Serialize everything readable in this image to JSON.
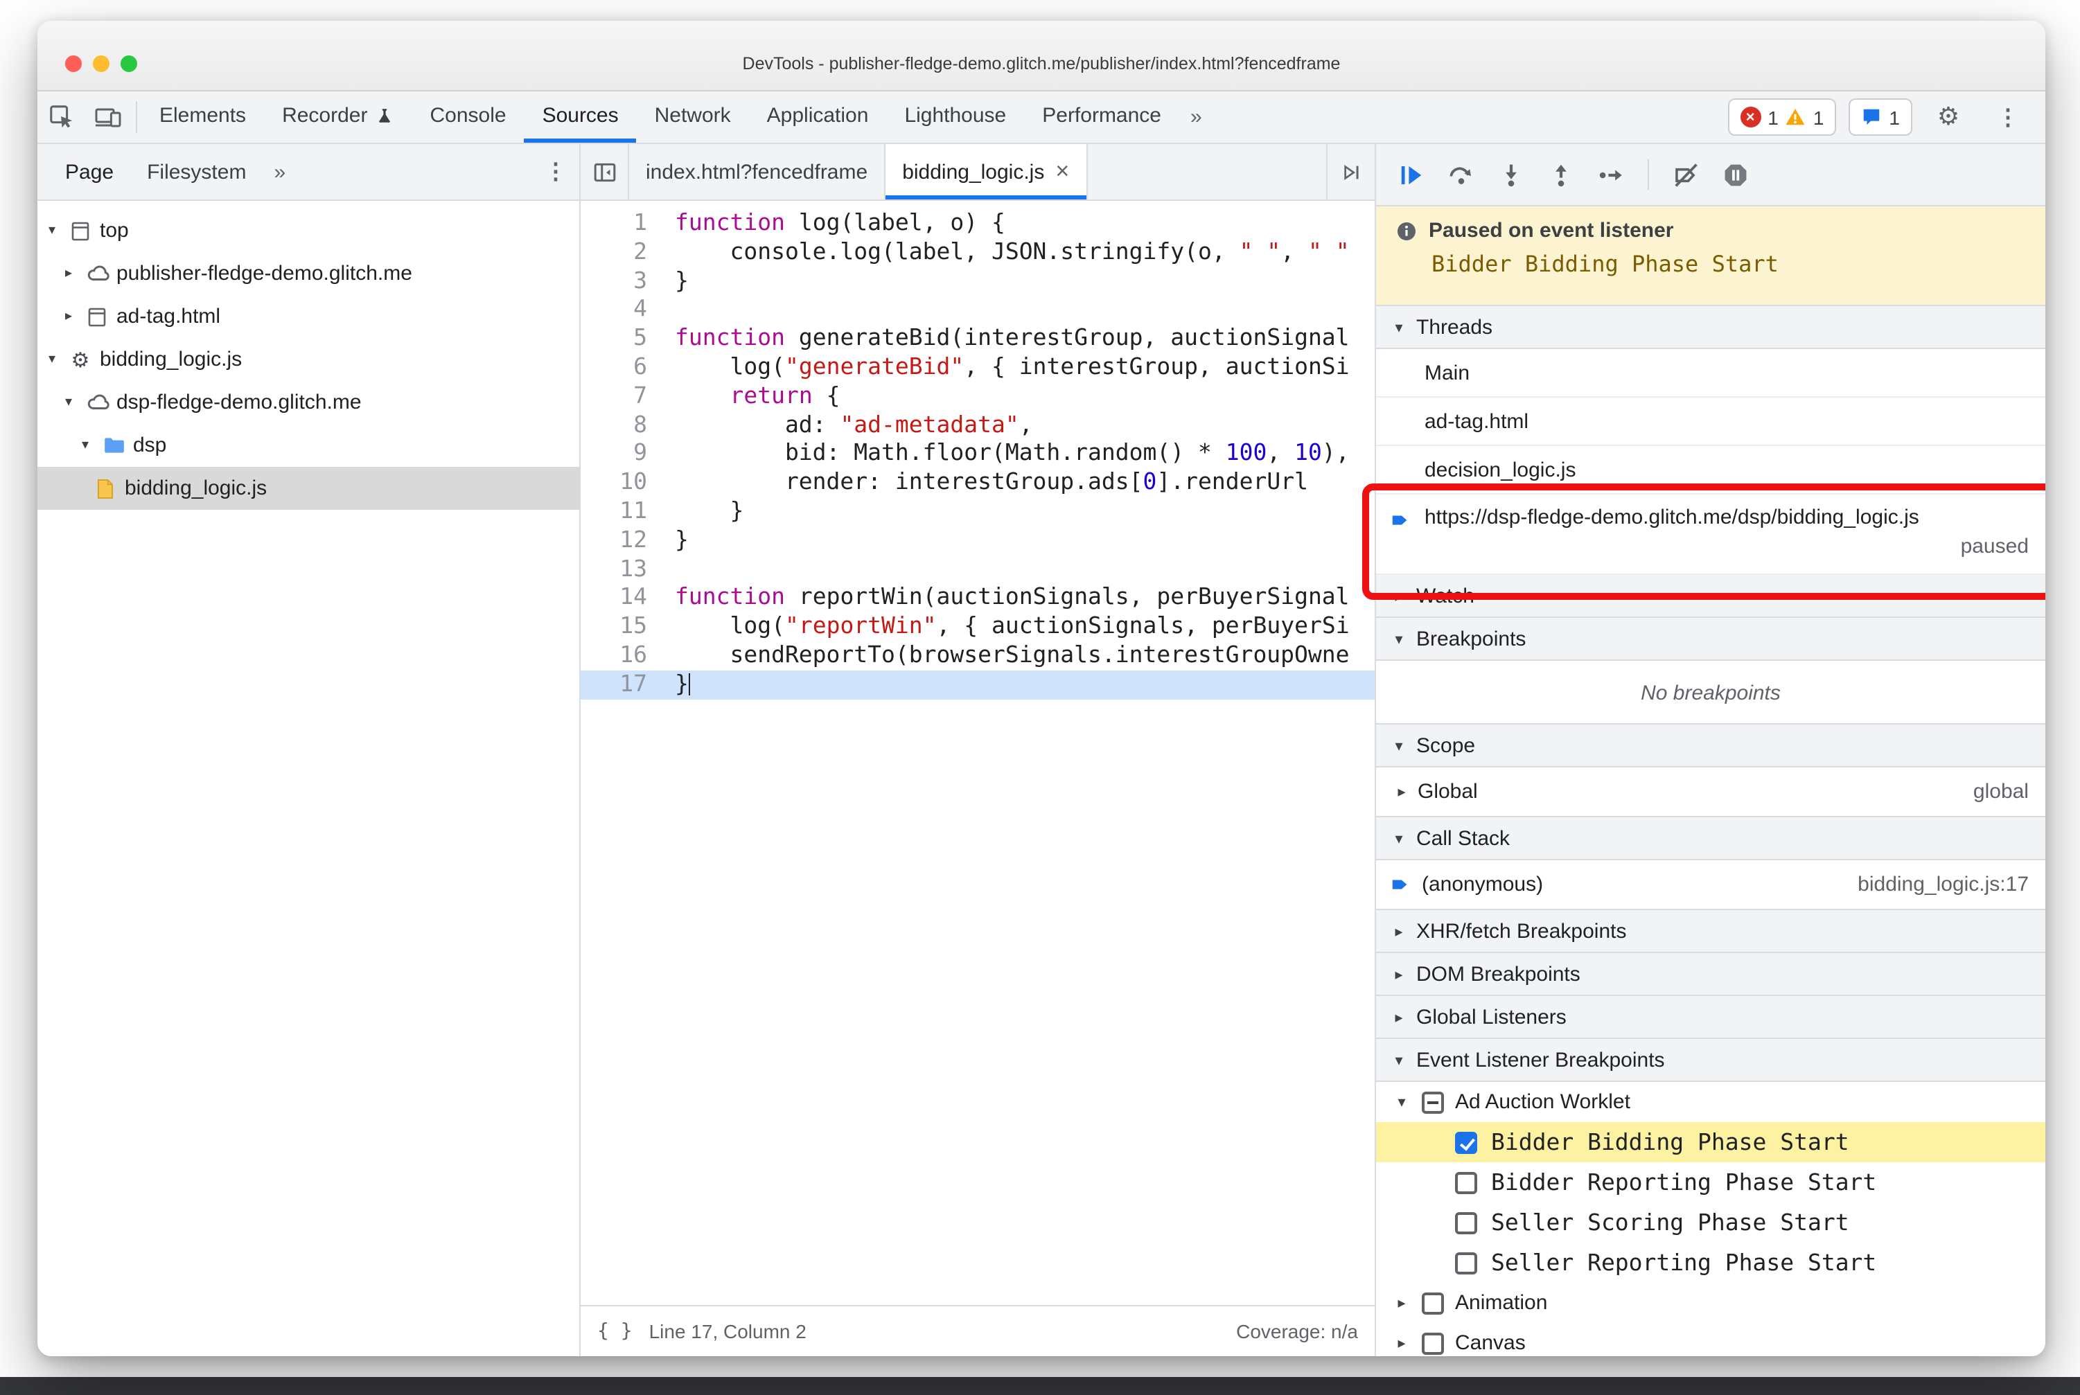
{
  "window": {
    "title": "DevTools - publisher-fledge-demo.glitch.me/publisher/index.html?fencedframe"
  },
  "toolbar": {
    "tabs": [
      "Elements",
      "Recorder",
      "Console",
      "Sources",
      "Network",
      "Application",
      "Lighthouse",
      "Performance"
    ],
    "error_count": "1",
    "warning_count": "1",
    "issues_count": "1"
  },
  "navigator": {
    "tabs": [
      "Page",
      "Filesystem"
    ],
    "tree": [
      {
        "label": "top"
      },
      {
        "label": "publisher-fledge-demo.glitch.me"
      },
      {
        "label": "ad-tag.html"
      },
      {
        "label": "bidding_logic.js"
      },
      {
        "label": "dsp-fledge-demo.glitch.me"
      },
      {
        "label": "dsp"
      },
      {
        "label": "bidding_logic.js"
      }
    ]
  },
  "editor": {
    "tabs": [
      "index.html?fencedframe",
      "bidding_logic.js"
    ],
    "status": {
      "line_col": "Line 17, Column 2",
      "coverage": "Coverage: n/a"
    },
    "lines": [
      {
        "n": 1,
        "t": [
          [
            "kw",
            "function"
          ],
          [
            "pl",
            " log(label, o) {"
          ]
        ]
      },
      {
        "n": 2,
        "t": [
          [
            "pl",
            "    console.log(label, JSON.stringify(o, "
          ],
          [
            "str",
            "\" \""
          ],
          [
            "pl",
            ", "
          ],
          [
            "str",
            "\" \""
          ]
        ]
      },
      {
        "n": 3,
        "t": [
          [
            "pl",
            "}"
          ]
        ]
      },
      {
        "n": 4,
        "t": []
      },
      {
        "n": 5,
        "t": [
          [
            "kw",
            "function"
          ],
          [
            "pl",
            " generateBid(interestGroup, auctionSignal"
          ]
        ]
      },
      {
        "n": 6,
        "t": [
          [
            "pl",
            "    log("
          ],
          [
            "str",
            "\"generateBid\""
          ],
          [
            "pl",
            ", { interestGroup, auctionSi"
          ]
        ]
      },
      {
        "n": 7,
        "t": [
          [
            "pl",
            "    "
          ],
          [
            "kw",
            "return"
          ],
          [
            "pl",
            " {"
          ]
        ]
      },
      {
        "n": 8,
        "t": [
          [
            "pl",
            "        ad: "
          ],
          [
            "str",
            "\"ad-metadata\""
          ],
          [
            "pl",
            ","
          ]
        ]
      },
      {
        "n": 9,
        "t": [
          [
            "pl",
            "        bid: Math.floor(Math.random() * "
          ],
          [
            "num",
            "100"
          ],
          [
            "pl",
            ", "
          ],
          [
            "num",
            "10"
          ],
          [
            "pl",
            "),"
          ]
        ]
      },
      {
        "n": 10,
        "t": [
          [
            "pl",
            "        render: interestGroup.ads["
          ],
          [
            "num",
            "0"
          ],
          [
            "pl",
            "].renderUrl"
          ]
        ]
      },
      {
        "n": 11,
        "t": [
          [
            "pl",
            "    }"
          ]
        ]
      },
      {
        "n": 12,
        "t": [
          [
            "pl",
            "}"
          ]
        ]
      },
      {
        "n": 13,
        "t": []
      },
      {
        "n": 14,
        "t": [
          [
            "kw",
            "function"
          ],
          [
            "pl",
            " reportWin(auctionSignals, perBuyerSignal"
          ]
        ]
      },
      {
        "n": 15,
        "t": [
          [
            "pl",
            "    log("
          ],
          [
            "str",
            "\"reportWin\""
          ],
          [
            "pl",
            ", { auctionSignals, perBuyerSi"
          ]
        ]
      },
      {
        "n": 16,
        "t": [
          [
            "pl",
            "    sendReportTo(browserSignals.interestGroupOwne"
          ]
        ]
      },
      {
        "n": 17,
        "t": [
          [
            "pl",
            "}"
          ]
        ],
        "exec": true
      }
    ]
  },
  "debugger": {
    "paused": {
      "title": "Paused on event listener",
      "subtitle": "Bidder Bidding Phase Start"
    },
    "threads": {
      "title": "Threads",
      "items": [
        "Main",
        "ad-tag.html",
        "decision_logic.js"
      ],
      "current": {
        "label": "https://dsp-fledge-demo.glitch.me/dsp/bidding_logic.js",
        "status": "paused"
      }
    },
    "watch": {
      "title": "Watch"
    },
    "breakpoints": {
      "title": "Breakpoints",
      "empty": "No breakpoints"
    },
    "scope": {
      "title": "Scope",
      "name": "Global",
      "value": "global"
    },
    "call_stack": {
      "title": "Call Stack",
      "frame": "(anonymous)",
      "location": "bidding_logic.js:17"
    },
    "xhr": {
      "title": "XHR/fetch Breakpoints"
    },
    "dom": {
      "title": "DOM Breakpoints"
    },
    "global_listeners": {
      "title": "Global Listeners"
    },
    "event_listener_breakpoints": {
      "title": "Event Listener Breakpoints",
      "category": "Ad Auction Worklet",
      "events": [
        "Bidder Bidding Phase Start",
        "Bidder Reporting Phase Start",
        "Seller Scoring Phase Start",
        "Seller Reporting Phase Start"
      ],
      "other_categories": [
        "Animation",
        "Canvas"
      ]
    }
  }
}
